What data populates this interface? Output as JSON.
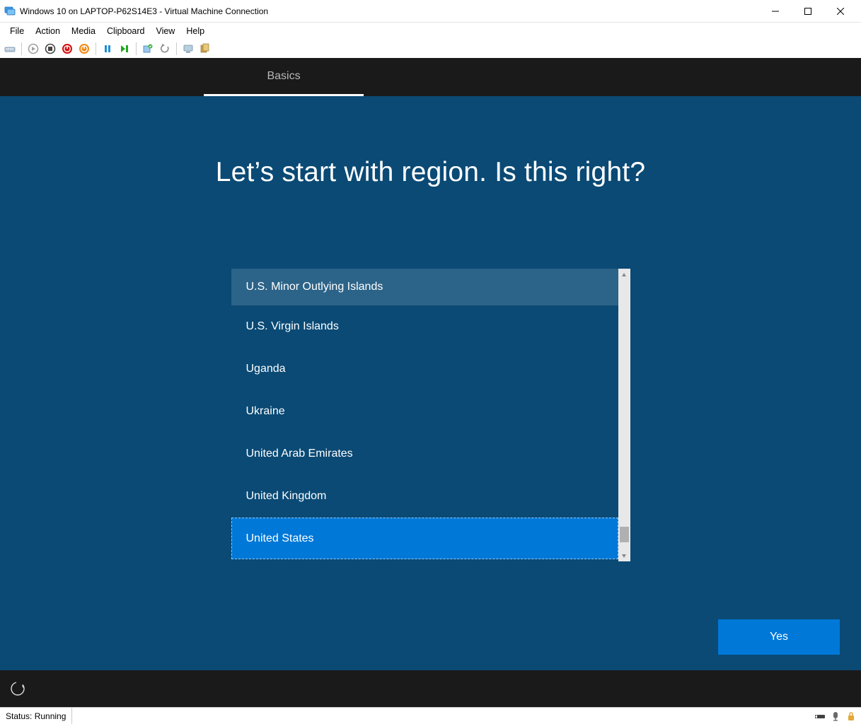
{
  "window": {
    "title": "Windows 10 on LAPTOP-P62S14E3 - Virtual Machine Connection"
  },
  "menu": {
    "file": "File",
    "action": "Action",
    "media": "Media",
    "clipboard": "Clipboard",
    "view": "View",
    "help": "Help"
  },
  "oobe": {
    "tab_label": "Basics",
    "heading": "Let’s start with region. Is this right?",
    "regions": [
      "U.S. Minor Outlying Islands",
      "U.S. Virgin Islands",
      "Uganda",
      "Ukraine",
      "United Arab Emirates",
      "United Kingdom",
      "United States"
    ],
    "selected_region_index": 6,
    "hovered_region_index": 0,
    "yes_label": "Yes"
  },
  "status": {
    "text": "Status: Running"
  }
}
